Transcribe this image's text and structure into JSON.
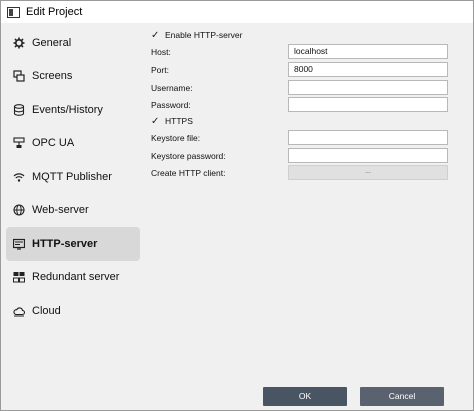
{
  "window": {
    "title": "Edit Project"
  },
  "sidebar": {
    "items": [
      {
        "label": "General",
        "icon": "gear-icon",
        "selected": false
      },
      {
        "label": "Screens",
        "icon": "screens-icon",
        "selected": false
      },
      {
        "label": "Events/History",
        "icon": "database-icon",
        "selected": false
      },
      {
        "label": "OPC UA",
        "icon": "opc-ua-icon",
        "selected": false
      },
      {
        "label": "MQTT Publisher",
        "icon": "wifi-icon",
        "selected": false
      },
      {
        "label": "Web-server",
        "icon": "globe-icon",
        "selected": false
      },
      {
        "label": "HTTP-server",
        "icon": "http-server-icon",
        "selected": true
      },
      {
        "label": "Redundant server",
        "icon": "redundant-server-icon",
        "selected": false
      },
      {
        "label": "Cloud",
        "icon": "cloud-icon",
        "selected": false
      }
    ]
  },
  "form": {
    "enable_http": {
      "label": "Enable HTTP-server",
      "checked": true,
      "mark": "✓"
    },
    "host": {
      "label": "Host:",
      "value": "localhost"
    },
    "port": {
      "label": "Port:",
      "value": "8000"
    },
    "username": {
      "label": "Username:",
      "value": ""
    },
    "password": {
      "label": "Password:",
      "value": ""
    },
    "https": {
      "label": "HTTPS",
      "checked": true,
      "mark": "✓"
    },
    "keystore_file": {
      "label": "Keystore file:",
      "value": ""
    },
    "keystore_password": {
      "label": "Keystore password:",
      "value": ""
    },
    "create_client": {
      "label": "Create HTTP client:",
      "button": "..."
    }
  },
  "footer": {
    "ok": "OK",
    "cancel": "Cancel"
  }
}
